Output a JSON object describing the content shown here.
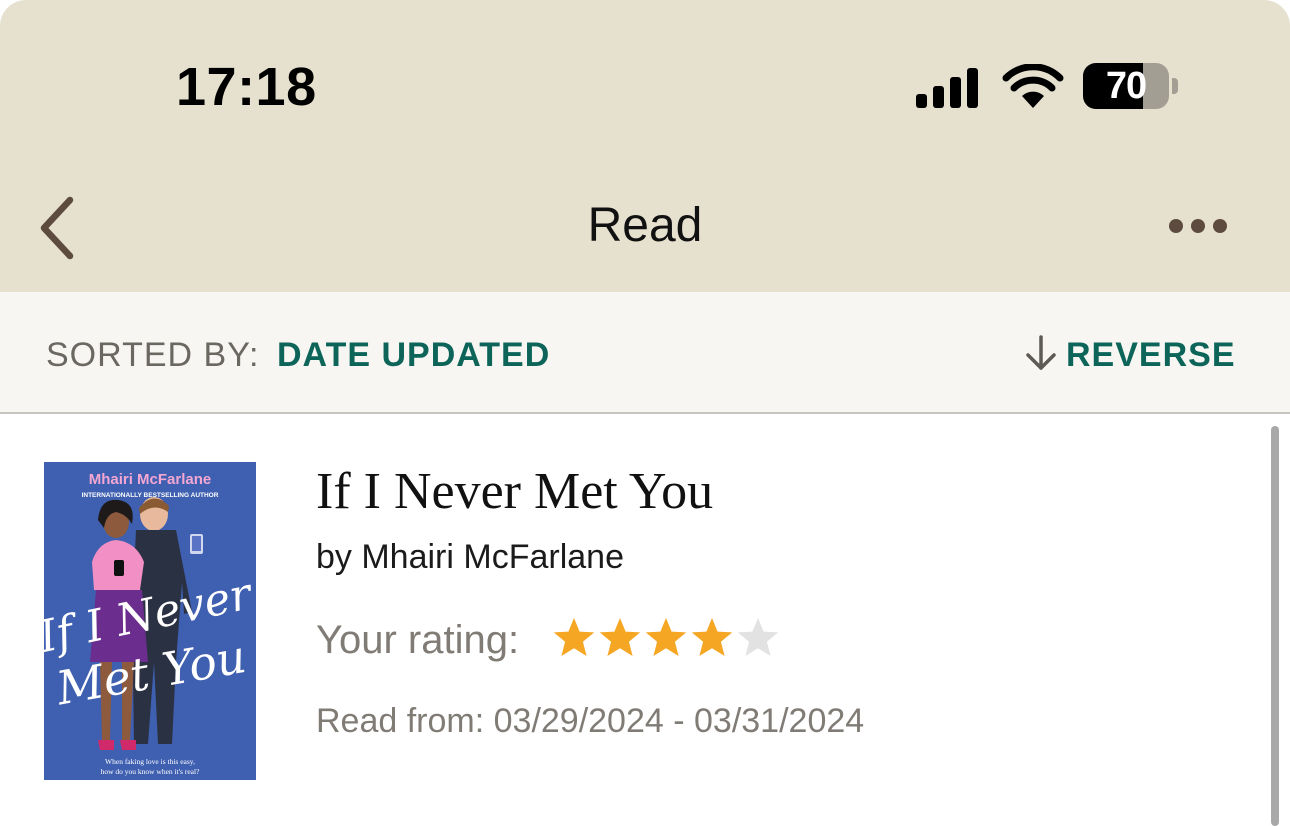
{
  "status_bar": {
    "time": "17:18",
    "battery_level": "70",
    "battery_fraction": 0.7,
    "icons": [
      "signal-icon",
      "wifi-icon",
      "battery-icon"
    ]
  },
  "nav": {
    "title": "Read",
    "back_icon": "chevron-left-icon",
    "more_icon": "ellipsis-icon"
  },
  "sort_bar": {
    "label": "SORTED BY:",
    "value": "DATE UPDATED",
    "reverse_label": "REVERSE",
    "reverse_icon": "arrow-down-icon"
  },
  "books": [
    {
      "title": "If I Never Met You",
      "author": "by Mhairi McFarlane",
      "rating_label": "Your rating:",
      "rating": 4,
      "rating_max": 5,
      "read_dates": "Read from: 03/29/2024 - 03/31/2024",
      "cover": {
        "author": "Mhairi McFarlane",
        "tagline": "INTERNATIONALLY BESTSELLING AUTHOR",
        "title_line1": "If I Never",
        "title_line2": "Met You",
        "blurb_line1": "When faking love is this easy,",
        "blurb_line2": "how do you know when it's real?"
      }
    }
  ],
  "colors": {
    "header_bg": "#e6e0cf",
    "sort_bar_bg": "#f8f6f3",
    "accent_teal": "#0d655a",
    "star_filled": "#f5a623",
    "star_empty": "#e2e2e2",
    "cover_blue": "#3f5fb0",
    "muted_text": "#807c75"
  }
}
